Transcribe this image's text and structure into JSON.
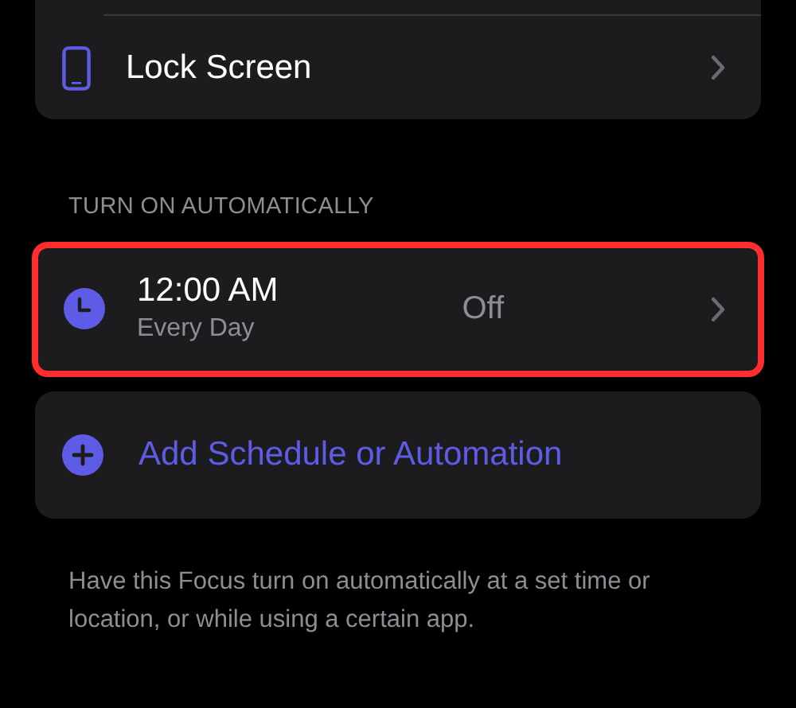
{
  "top_group": {
    "items": [
      {
        "label": "Lock Screen"
      }
    ]
  },
  "section": {
    "header": "TURN ON AUTOMATICALLY",
    "schedules": [
      {
        "time": "12:00 AM",
        "repeat": "Every Day",
        "status": "Off",
        "highlighted": true
      }
    ],
    "add_button": {
      "label": "Add Schedule or Automation"
    },
    "footer": "Have this Focus turn on automatically at a set time or location, or while using a certain app."
  }
}
